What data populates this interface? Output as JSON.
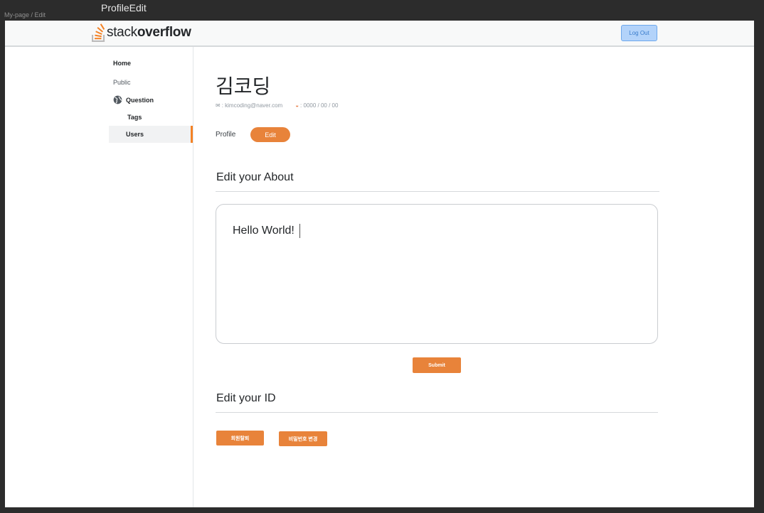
{
  "canvas": {
    "breadcrumb": "My-page / Edit",
    "frame_title": "ProfileEdit"
  },
  "header": {
    "logo_light": "stack",
    "logo_bold": "overflow",
    "logout_label": "Log Out"
  },
  "sidebar": {
    "items": [
      {
        "label": "Home"
      },
      {
        "label": "Public"
      },
      {
        "label": "Question"
      },
      {
        "label": "Tags"
      },
      {
        "label": "Users"
      }
    ]
  },
  "profile": {
    "name": "김코딩",
    "email": ": kimcoding@naver.com",
    "birthday": ": 0000 / 00 / 00"
  },
  "tabs": {
    "profile": "Profile",
    "edit": "Edit"
  },
  "about": {
    "title": "Edit your About",
    "value": "Hello World!",
    "submit_label": "Submit"
  },
  "id_section": {
    "title": "Edit your ID",
    "withdraw_label": "회원탈퇴",
    "change_password_label": "비밀번호 변경"
  },
  "colors": {
    "accent": "#e8833a",
    "logout_bg": "#b3d3fa"
  }
}
